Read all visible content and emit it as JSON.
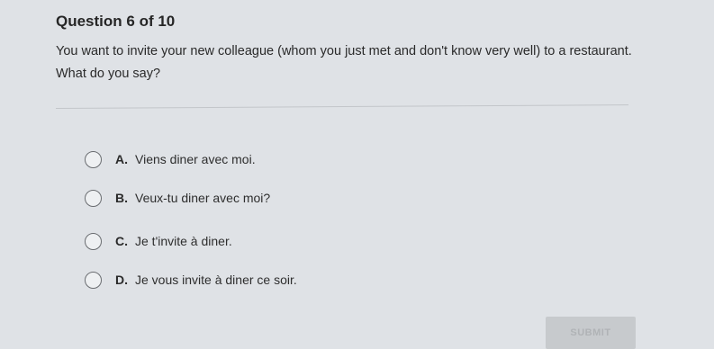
{
  "question": {
    "header": "Question 6 of 10",
    "prompt": "You want to invite your new colleague (whom you just met and don't know very well) to a restaurant. What do you say?"
  },
  "options": [
    {
      "letter": "A.",
      "text": "Viens diner avec moi."
    },
    {
      "letter": "B.",
      "text": "Veux-tu diner avec moi?"
    },
    {
      "letter": "C.",
      "text": "Je t'invite à diner."
    },
    {
      "letter": "D.",
      "text": "Je vous invite à diner ce soir."
    }
  ],
  "submit": {
    "label": "SUBMIT"
  }
}
